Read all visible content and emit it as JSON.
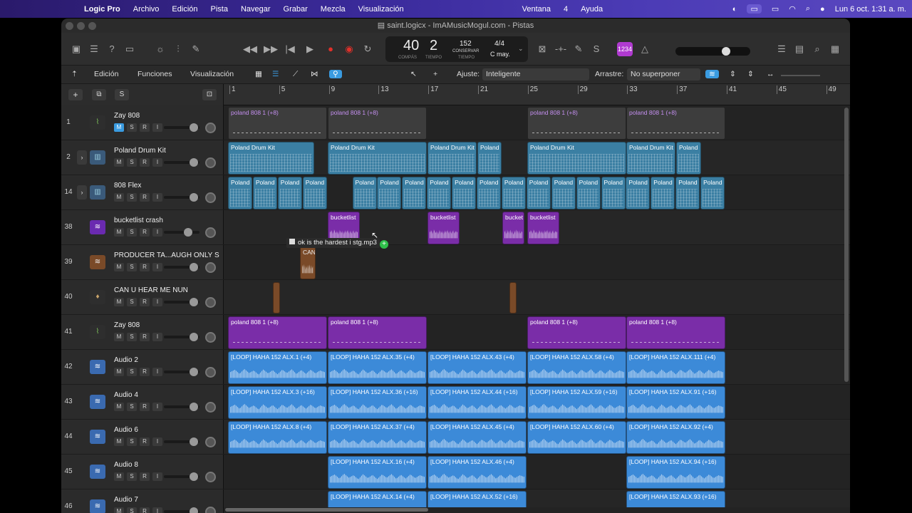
{
  "menubar": {
    "app": "Logic Pro",
    "items": [
      "Archivo",
      "Edición",
      "Pista",
      "Navegar",
      "Grabar",
      "Mezcla",
      "Visualización"
    ],
    "right_items": [
      "Ventana",
      "4",
      "Ayuda"
    ],
    "datetime": "Lun 6 oct.  1:31 a. m."
  },
  "window": {
    "title": "saint.logicx - ImAMusicMogul.com - Pistas"
  },
  "lcd": {
    "bar": "40",
    "beat": "2",
    "bar_label": "COMPÁS",
    "beat_label": "TIEMPO",
    "tempo": "152",
    "tempo_mode": "CONSERVAR",
    "tempo_label": "TIEMPO",
    "signature": "4/4",
    "key": "C may."
  },
  "count_badge": "1234",
  "toolbar": {
    "edit": "Edición",
    "functions": "Funciones",
    "view": "Visualización",
    "snap_label": "Ajuste:",
    "snap_value": "Inteligente",
    "drag_label": "Arrastre:",
    "drag_value": "No superponer"
  },
  "trackheader": {
    "add": "+",
    "s": "S"
  },
  "ruler": [
    "1",
    "5",
    "9",
    "13",
    "17",
    "21",
    "25",
    "29",
    "33",
    "37",
    "41",
    "45",
    "49"
  ],
  "tracks": [
    {
      "num": "1",
      "name": "Zay 808",
      "icon": "synth-icon"
    },
    {
      "num": "2",
      "name": "Poland Drum Kit",
      "icon": "drum-machine-icon"
    },
    {
      "num": "14",
      "name": "808 Flex",
      "icon": "drum-machine-icon"
    },
    {
      "num": "38",
      "name": "bucketlist crash",
      "icon": "waveform-icon"
    },
    {
      "num": "39",
      "name": "PRODUCER TA...AUGH ONLY S",
      "icon": "waveform-icon"
    },
    {
      "num": "40",
      "name": "CAN U HEAR ME NUN",
      "icon": "microphone-icon"
    },
    {
      "num": "41",
      "name": "Zay 808",
      "icon": "synth-icon"
    },
    {
      "num": "42",
      "name": "Audio 2",
      "icon": "waveform-icon"
    },
    {
      "num": "43",
      "name": "Audio 4",
      "icon": "waveform-icon"
    },
    {
      "num": "44",
      "name": "Audio 6",
      "icon": "waveform-icon"
    },
    {
      "num": "45",
      "name": "Audio 8",
      "icon": "waveform-icon"
    },
    {
      "num": "46",
      "name": "Audio 7",
      "icon": "waveform-icon"
    }
  ],
  "buttons": {
    "m": "M",
    "s": "S",
    "r": "R",
    "i": "I"
  },
  "regions": {
    "p808": "poland 808 1 (+8)",
    "pdk": "Poland Drum Kit",
    "poland": "Poland",
    "bucket": "bucketlist",
    "bucket_short": "bucket",
    "can": "CAN",
    "a1": "[LOOP] HAHA 152 ALX.1 (+4)",
    "a35": "[LOOP] HAHA 152 ALX.35 (+4)",
    "a43": "[LOOP] HAHA 152 ALX.43 (+4)",
    "a58": "[LOOP] HAHA 152 ALX.58 (+4)",
    "a111": "[LOOP] HAHA 152 ALX.111 (+4)",
    "b3": "[LOOP] HAHA 152 ALX.3 (+16)",
    "b36": "[LOOP] HAHA 152 ALX.36 (+16)",
    "b44": "[LOOP] HAHA 152 ALX.44 (+16)",
    "b59": "[LOOP] HAHA 152 ALX.59 (+16)",
    "b91": "[LOOP] HAHA 152 ALX.91 (+16)",
    "c8": "[LOOP] HAHA 152 ALX.8 (+4)",
    "c37": "[LOOP] HAHA 152 ALX.37 (+4)",
    "c45": "[LOOP] HAHA 152 ALX.45 (+4)",
    "c60": "[LOOP] HAHA 152 ALX.60 (+4)",
    "c92": "[LOOP] HAHA 152 ALX.92 (+4)",
    "d16": "[LOOP] HAHA 152 ALX.16 (+4)",
    "d46": "[LOOP] HAHA 152 ALX.46 (+4)",
    "d94": "[LOOP] HAHA 152 ALX.94 (+16)",
    "e14": "[LOOP] HAHA 152 ALX.14 (+4)",
    "e52": "[LOOP] HAHA 152 ALX.52 (+16)",
    "e93": "[LOOP] HAHA 152 ALX.93 (+16)"
  },
  "drag_tooltip": "ok is the hardest i stg.mp3",
  "colors": {
    "grey": "#3d3d3d",
    "teal": "#3b7fa3",
    "purple": "#7a2da8",
    "blue": "#3c8ad8",
    "accent": "#3a9be0"
  }
}
